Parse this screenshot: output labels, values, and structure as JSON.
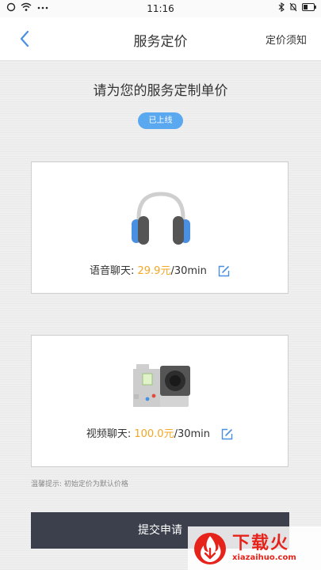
{
  "status_bar": {
    "time": "11:16"
  },
  "nav": {
    "title": "服务定价",
    "right_link": "定价须知"
  },
  "heading": "请为您的服务定制单价",
  "badge": "已上线",
  "voice": {
    "label": "语音聊天:",
    "price": "29.9元",
    "unit": "/30min"
  },
  "video": {
    "label": "视频聊天:",
    "price": "100.0元",
    "unit": "/30min"
  },
  "tip": "温馨提示: 初始定价为默认价格",
  "submit_label": "提交申请",
  "watermark": {
    "cn": "下载火",
    "en": "xiazaihuo.com"
  },
  "colors": {
    "accent_blue": "#5aa8f0",
    "price_orange": "#f5a623",
    "button_dark": "#3c3f4c",
    "watermark_red": "#e6231a"
  },
  "icons": [
    "wifi-icon",
    "bluetooth-icon",
    "battery-icon",
    "back-chevron-icon",
    "headphones-icon",
    "camera-icon",
    "edit-icon"
  ]
}
